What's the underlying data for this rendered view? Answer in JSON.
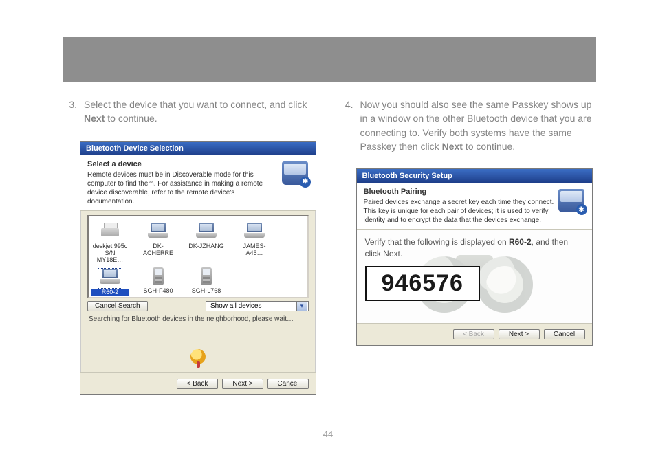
{
  "page_number": "44",
  "step3": {
    "num": "3.",
    "text_before": "Select the device that you want to connect, and click ",
    "bold": "Next",
    "text_after": " to continue."
  },
  "step4": {
    "num": "4.",
    "text_before": "Now you should also see the same Passkey shows up in a window on the other Bluetooth device that you are connecting to.  Verify both systems have the same Passkey then click ",
    "bold": "Next",
    "text_after": " to continue."
  },
  "dialog1": {
    "title": "Bluetooth Device Selection",
    "header_title": "Select a device",
    "header_body": "Remote devices must be in Discoverable mode for this computer to find them. For assistance in making a remote device discoverable, refer to the remote device's documentation.",
    "devices": [
      {
        "label": "deskjet 995c S/N MY18E…",
        "type": "printer"
      },
      {
        "label": "DK-ACHERRE",
        "type": "laptop"
      },
      {
        "label": "DK-JZHANG",
        "type": "laptop"
      },
      {
        "label": "JAMES-A45…",
        "type": "laptop"
      },
      {
        "label": "R60-2",
        "type": "laptop",
        "selected": true
      },
      {
        "label": "SGH-F480",
        "type": "phone"
      },
      {
        "label": "SGH-L768",
        "type": "phone"
      }
    ],
    "cancel_search": "Cancel Search",
    "show_all": "Show all devices",
    "status": "Searching for Bluetooth devices in the neighborhood, please wait…",
    "back": "< Back",
    "next": "Next >",
    "cancel": "Cancel"
  },
  "dialog2": {
    "title": "Bluetooth Security Setup",
    "header_title": "Bluetooth Pairing",
    "header_body": "Paired devices exchange a secret key each time they connect. This key is unique for each pair of devices; it is used to verify identity and to encrypt the data that the devices exchange.",
    "verify_before": "Verify that the following is displayed on ",
    "verify_device": "R60-2",
    "verify_after": ", and then click Next.",
    "passkey": "946576",
    "back": "< Back",
    "next": "Next >",
    "cancel": "Cancel"
  }
}
